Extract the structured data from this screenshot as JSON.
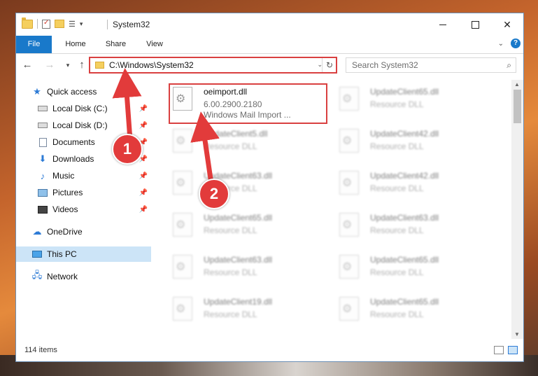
{
  "window": {
    "title": "System32"
  },
  "ribbon": {
    "tabs": [
      "File",
      "Home",
      "Share",
      "View"
    ]
  },
  "nav": {
    "address": "C:\\Windows\\System32",
    "search_placeholder": "Search System32"
  },
  "sidebar": {
    "items": [
      {
        "label": "Quick access",
        "icon": "star-icon"
      },
      {
        "label": "Local Disk (C:)",
        "icon": "drive-icon",
        "pinned": true
      },
      {
        "label": "Local Disk (D:)",
        "icon": "drive-icon",
        "pinned": true
      },
      {
        "label": "Documents",
        "icon": "documents-icon",
        "pinned": true
      },
      {
        "label": "Downloads",
        "icon": "download-icon",
        "pinned": true
      },
      {
        "label": "Music",
        "icon": "music-icon",
        "pinned": true
      },
      {
        "label": "Pictures",
        "icon": "pictures-icon",
        "pinned": true
      },
      {
        "label": "Videos",
        "icon": "videos-icon",
        "pinned": true
      },
      {
        "label": "OneDrive",
        "icon": "cloud-icon"
      },
      {
        "label": "This PC",
        "icon": "computer-icon",
        "selected": true
      },
      {
        "label": "Network",
        "icon": "network-icon"
      }
    ]
  },
  "files": {
    "highlighted": {
      "name": "oeimport.dll",
      "version": "6.00.2900.2180",
      "description": "Windows Mail Import ..."
    },
    "left_column": [
      {
        "name": "UpdateClient5.dll",
        "type": "Resource DLL"
      },
      {
        "name": "UpdateClient63.dll",
        "type": "Resource DLL"
      },
      {
        "name": "UpdateClient65.dll",
        "type": "Resource DLL"
      },
      {
        "name": "UpdateClient63.dll",
        "type": "Resource DLL"
      },
      {
        "name": "UpdateClient19.dll",
        "type": "Resource DLL"
      }
    ],
    "right_column": [
      {
        "name": "UpdateClient65.dll",
        "type": "Resource DLL"
      },
      {
        "name": "UpdateClient42.dll",
        "type": "Resource DLL"
      },
      {
        "name": "UpdateClient42.dll",
        "type": "Resource DLL"
      },
      {
        "name": "UpdateClient63.dll",
        "type": "Resource DLL"
      },
      {
        "name": "UpdateClient65.dll",
        "type": "Resource DLL"
      },
      {
        "name": "UpdateClient65.dll",
        "type": "Resource DLL"
      }
    ]
  },
  "status": {
    "item_count": "114 items"
  },
  "callouts": [
    "1",
    "2"
  ],
  "colors": {
    "accent": "#1979ca",
    "highlight": "#d94040",
    "selected_bg": "#cce4f7"
  }
}
